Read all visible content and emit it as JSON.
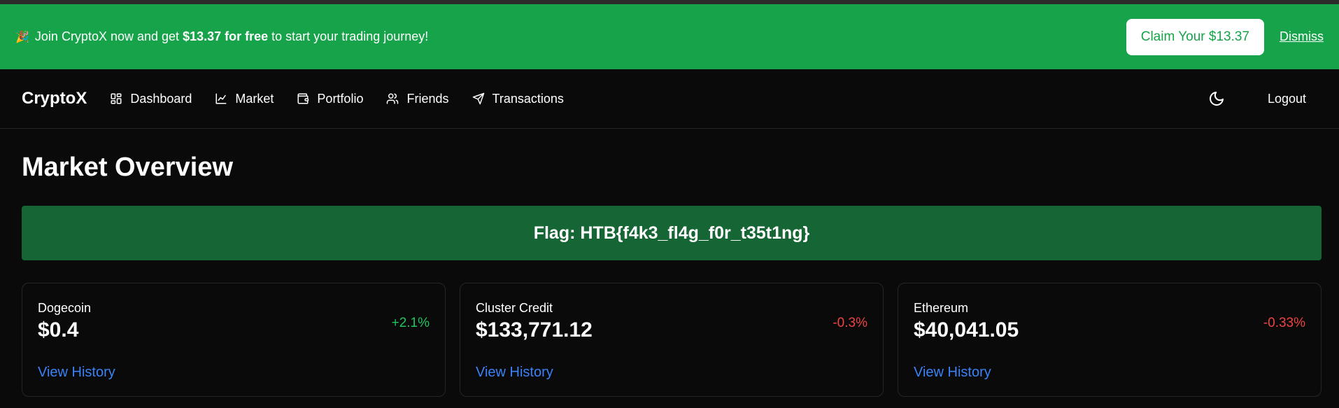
{
  "promo": {
    "emoji": "🎉",
    "text_before": "Join CryptoX now and get",
    "text_bold": "$13.37 for free",
    "text_after": "to start your trading journey!",
    "claim_label": "Claim Your $13.37",
    "dismiss_label": "Dismiss"
  },
  "nav": {
    "brand": "CryptoX",
    "items": [
      {
        "label": "Dashboard",
        "icon": "dashboard-icon"
      },
      {
        "label": "Market",
        "icon": "chart-icon"
      },
      {
        "label": "Portfolio",
        "icon": "wallet-icon"
      },
      {
        "label": "Friends",
        "icon": "users-icon"
      },
      {
        "label": "Transactions",
        "icon": "send-icon"
      }
    ],
    "theme_icon": "moon-icon",
    "logout_label": "Logout"
  },
  "page": {
    "title": "Market Overview",
    "flag": "Flag: HTB{f4k3_fl4g_f0r_t35t1ng}"
  },
  "cards": [
    {
      "name": "Dogecoin",
      "price": "$0.4",
      "change": "+2.1%",
      "direction": "up",
      "link": "View History"
    },
    {
      "name": "Cluster Credit",
      "price": "$133,771.12",
      "change": "-0.3%",
      "direction": "down",
      "link": "View History"
    },
    {
      "name": "Ethereum",
      "price": "$40,041.05",
      "change": "-0.33%",
      "direction": "down",
      "link": "View History"
    }
  ],
  "colors": {
    "promo_bg": "#16a34a",
    "flag_bg": "#166534",
    "positive": "#22c55e",
    "negative": "#ef4444",
    "link": "#3b82f6"
  }
}
